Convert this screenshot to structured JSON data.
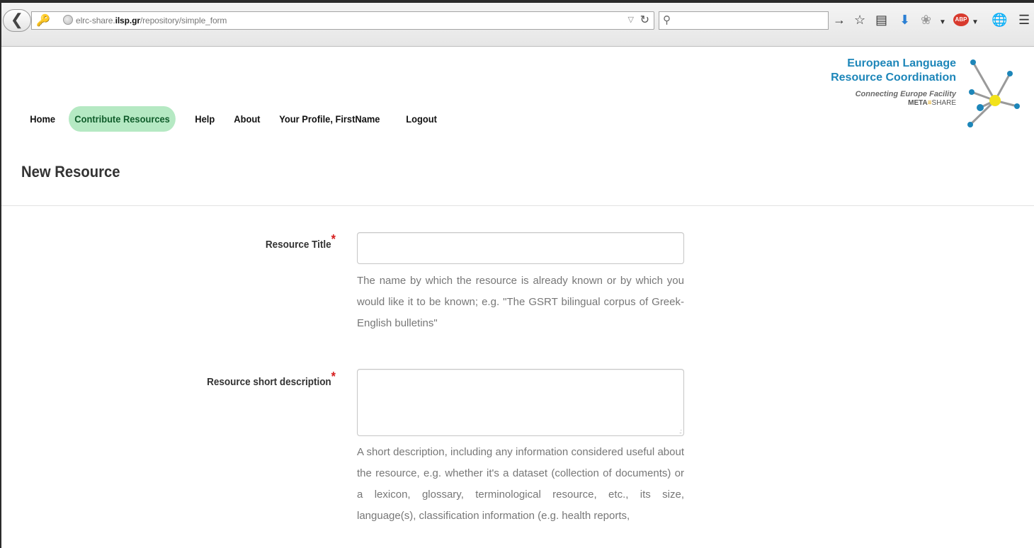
{
  "browser": {
    "url_prefix": "elrc-share.",
    "url_host": "ilsp.gr",
    "url_path": "/repository/simple_form",
    "icons": [
      "back-icon",
      "key-icon",
      "globe-icon",
      "reload-icon",
      "search-icon",
      "forward-arrow-icon",
      "bookmark-star-icon",
      "reading-list-icon",
      "download-icon",
      "addon-icon",
      "adblock-icon",
      "globe-addon-icon",
      "menu-icon"
    ],
    "abp_label": "ABP"
  },
  "header": {
    "nav": [
      {
        "label": "Home",
        "active": false
      },
      {
        "label": "Contribute Resources",
        "active": true
      },
      {
        "label": "Help",
        "active": false
      },
      {
        "label": "About",
        "active": false
      },
      {
        "label": "Your Profile, FirstName",
        "active": false
      },
      {
        "label": "Logout",
        "active": false
      }
    ],
    "logo": {
      "line1": "European Language",
      "line2": "Resource Coordination",
      "line3": "Connecting Europe Facility",
      "line4_a": "META",
      "line4_b": "SHARE"
    }
  },
  "page": {
    "title": "New Resource"
  },
  "form": {
    "fields": [
      {
        "label": "Resource Title",
        "required_mark": "*",
        "value": "",
        "help": "The name by which the resource is already known or by which you would like it to be known; e.g. \"The GSRT bilingual corpus of Greek-English bulletins\""
      },
      {
        "label": "Resource short description",
        "required_mark": "*",
        "value": "",
        "help": "A short description, including any information considered useful about the resource, e.g. whether it's a dataset (collection of documents) or a lexicon, glossary, terminological resource, etc., its size, language(s), classification information (e.g. health reports,"
      }
    ]
  },
  "colors": {
    "accent": "#1d86b9",
    "nav_active_bg": "#b5e9c3",
    "required": "#d62020"
  }
}
